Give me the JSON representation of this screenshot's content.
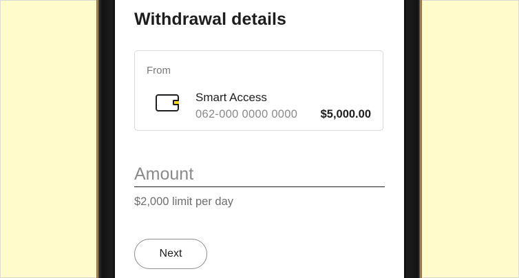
{
  "page": {
    "title": "Withdrawal details"
  },
  "from_card": {
    "label": "From",
    "icon": "wallet-card-icon",
    "account_name": "Smart Access",
    "account_number": "062-000 0000 0000",
    "balance": "$5,000.00"
  },
  "amount": {
    "placeholder": "Amount",
    "value": "",
    "hint": "$2,000 limit per day"
  },
  "actions": {
    "next_label": "Next"
  },
  "colors": {
    "background": "#fffbca",
    "accent_chip": "#f7d917",
    "text": "#1d1d1d",
    "muted_text": "#8a8a8a"
  }
}
